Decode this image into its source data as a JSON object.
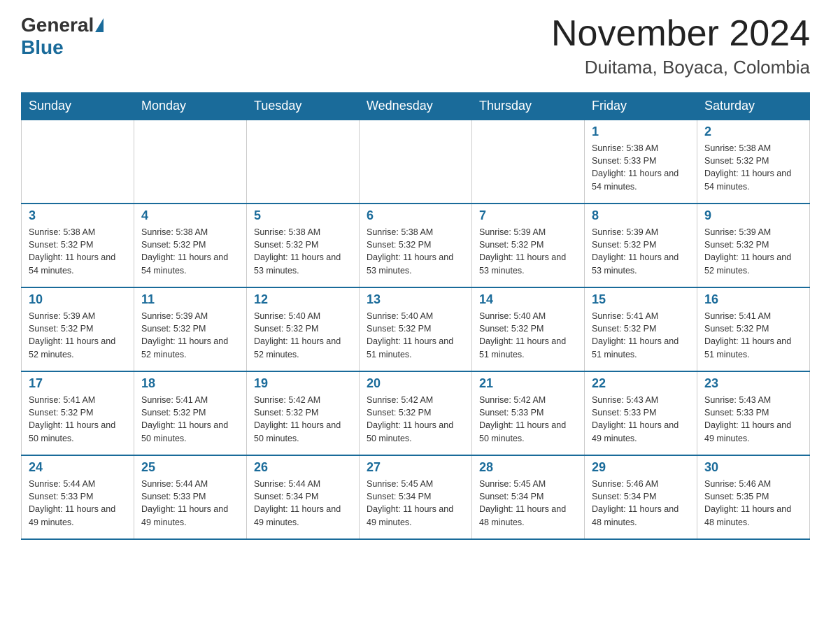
{
  "header": {
    "logo": {
      "general": "General",
      "blue": "Blue"
    },
    "title": "November 2024",
    "location": "Duitama, Boyaca, Colombia"
  },
  "days_of_week": [
    "Sunday",
    "Monday",
    "Tuesday",
    "Wednesday",
    "Thursday",
    "Friday",
    "Saturday"
  ],
  "weeks": [
    [
      {
        "day": "",
        "info": ""
      },
      {
        "day": "",
        "info": ""
      },
      {
        "day": "",
        "info": ""
      },
      {
        "day": "",
        "info": ""
      },
      {
        "day": "",
        "info": ""
      },
      {
        "day": "1",
        "info": "Sunrise: 5:38 AM\nSunset: 5:33 PM\nDaylight: 11 hours and 54 minutes."
      },
      {
        "day": "2",
        "info": "Sunrise: 5:38 AM\nSunset: 5:32 PM\nDaylight: 11 hours and 54 minutes."
      }
    ],
    [
      {
        "day": "3",
        "info": "Sunrise: 5:38 AM\nSunset: 5:32 PM\nDaylight: 11 hours and 54 minutes."
      },
      {
        "day": "4",
        "info": "Sunrise: 5:38 AM\nSunset: 5:32 PM\nDaylight: 11 hours and 54 minutes."
      },
      {
        "day": "5",
        "info": "Sunrise: 5:38 AM\nSunset: 5:32 PM\nDaylight: 11 hours and 53 minutes."
      },
      {
        "day": "6",
        "info": "Sunrise: 5:38 AM\nSunset: 5:32 PM\nDaylight: 11 hours and 53 minutes."
      },
      {
        "day": "7",
        "info": "Sunrise: 5:39 AM\nSunset: 5:32 PM\nDaylight: 11 hours and 53 minutes."
      },
      {
        "day": "8",
        "info": "Sunrise: 5:39 AM\nSunset: 5:32 PM\nDaylight: 11 hours and 53 minutes."
      },
      {
        "day": "9",
        "info": "Sunrise: 5:39 AM\nSunset: 5:32 PM\nDaylight: 11 hours and 52 minutes."
      }
    ],
    [
      {
        "day": "10",
        "info": "Sunrise: 5:39 AM\nSunset: 5:32 PM\nDaylight: 11 hours and 52 minutes."
      },
      {
        "day": "11",
        "info": "Sunrise: 5:39 AM\nSunset: 5:32 PM\nDaylight: 11 hours and 52 minutes."
      },
      {
        "day": "12",
        "info": "Sunrise: 5:40 AM\nSunset: 5:32 PM\nDaylight: 11 hours and 52 minutes."
      },
      {
        "day": "13",
        "info": "Sunrise: 5:40 AM\nSunset: 5:32 PM\nDaylight: 11 hours and 51 minutes."
      },
      {
        "day": "14",
        "info": "Sunrise: 5:40 AM\nSunset: 5:32 PM\nDaylight: 11 hours and 51 minutes."
      },
      {
        "day": "15",
        "info": "Sunrise: 5:41 AM\nSunset: 5:32 PM\nDaylight: 11 hours and 51 minutes."
      },
      {
        "day": "16",
        "info": "Sunrise: 5:41 AM\nSunset: 5:32 PM\nDaylight: 11 hours and 51 minutes."
      }
    ],
    [
      {
        "day": "17",
        "info": "Sunrise: 5:41 AM\nSunset: 5:32 PM\nDaylight: 11 hours and 50 minutes."
      },
      {
        "day": "18",
        "info": "Sunrise: 5:41 AM\nSunset: 5:32 PM\nDaylight: 11 hours and 50 minutes."
      },
      {
        "day": "19",
        "info": "Sunrise: 5:42 AM\nSunset: 5:32 PM\nDaylight: 11 hours and 50 minutes."
      },
      {
        "day": "20",
        "info": "Sunrise: 5:42 AM\nSunset: 5:32 PM\nDaylight: 11 hours and 50 minutes."
      },
      {
        "day": "21",
        "info": "Sunrise: 5:42 AM\nSunset: 5:33 PM\nDaylight: 11 hours and 50 minutes."
      },
      {
        "day": "22",
        "info": "Sunrise: 5:43 AM\nSunset: 5:33 PM\nDaylight: 11 hours and 49 minutes."
      },
      {
        "day": "23",
        "info": "Sunrise: 5:43 AM\nSunset: 5:33 PM\nDaylight: 11 hours and 49 minutes."
      }
    ],
    [
      {
        "day": "24",
        "info": "Sunrise: 5:44 AM\nSunset: 5:33 PM\nDaylight: 11 hours and 49 minutes."
      },
      {
        "day": "25",
        "info": "Sunrise: 5:44 AM\nSunset: 5:33 PM\nDaylight: 11 hours and 49 minutes."
      },
      {
        "day": "26",
        "info": "Sunrise: 5:44 AM\nSunset: 5:34 PM\nDaylight: 11 hours and 49 minutes."
      },
      {
        "day": "27",
        "info": "Sunrise: 5:45 AM\nSunset: 5:34 PM\nDaylight: 11 hours and 49 minutes."
      },
      {
        "day": "28",
        "info": "Sunrise: 5:45 AM\nSunset: 5:34 PM\nDaylight: 11 hours and 48 minutes."
      },
      {
        "day": "29",
        "info": "Sunrise: 5:46 AM\nSunset: 5:34 PM\nDaylight: 11 hours and 48 minutes."
      },
      {
        "day": "30",
        "info": "Sunrise: 5:46 AM\nSunset: 5:35 PM\nDaylight: 11 hours and 48 minutes."
      }
    ]
  ]
}
